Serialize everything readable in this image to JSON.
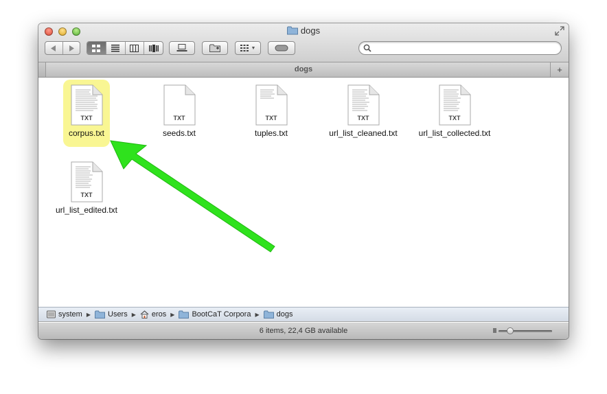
{
  "window": {
    "title": "dogs"
  },
  "toolbar": {
    "back_icon": "back-arrow-icon",
    "forward_icon": "forward-arrow-icon",
    "view_modes": [
      "icon-view",
      "list-view",
      "column-view",
      "coverflow-view"
    ],
    "active_view": "icon-view",
    "search": {
      "value": "",
      "placeholder": ""
    }
  },
  "tab": {
    "label": "dogs",
    "add_label": "+"
  },
  "files": [
    {
      "name": "corpus.txt",
      "type": "TXT",
      "highlighted": true
    },
    {
      "name": "seeds.txt",
      "type": "TXT",
      "highlighted": false
    },
    {
      "name": "tuples.txt",
      "type": "TXT",
      "highlighted": false
    },
    {
      "name": "url_list_cleaned.txt",
      "type": "TXT",
      "highlighted": false
    },
    {
      "name": "url_list_collected.txt",
      "type": "TXT",
      "highlighted": false
    },
    {
      "name": "url_list_edited.txt",
      "type": "TXT",
      "highlighted": false
    }
  ],
  "path": [
    {
      "label": "system",
      "icon": "hard-drive-icon"
    },
    {
      "label": "Users",
      "icon": "folder-icon"
    },
    {
      "label": "eros",
      "icon": "home-icon"
    },
    {
      "label": "BootCaT Corpora",
      "icon": "folder-icon"
    },
    {
      "label": "dogs",
      "icon": "folder-icon"
    }
  ],
  "status": {
    "text": "6 items, 22,4 GB available"
  },
  "icon_size_slider": {
    "value": 0.2
  },
  "colors": {
    "highlight": "#f6f26a",
    "arrow": "#2fe21d",
    "folder": "#8fb4d9"
  }
}
